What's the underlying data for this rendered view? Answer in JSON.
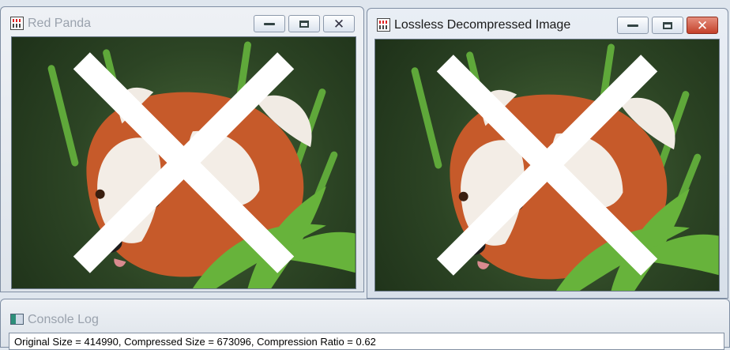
{
  "windows": {
    "original": {
      "title": "Red Panda",
      "image_subject": "red-panda-photo"
    },
    "decompressed": {
      "title": "Lossless Decompressed Image",
      "image_subject": "red-panda-photo"
    }
  },
  "console": {
    "title": "Console Log",
    "log_line": "Original Size = 414990, Compressed Size = 673096, Compression Ratio = 0.62"
  },
  "icons": {
    "window_icon": "image-file-icon",
    "console_icon": "console-icon",
    "minimize": "minimize-icon",
    "maximize": "maximize-icon",
    "close": "close-icon"
  },
  "colors": {
    "close_active": "#c4402a",
    "frame": "#7f8ea3",
    "photo_background": "#2c4424"
  }
}
